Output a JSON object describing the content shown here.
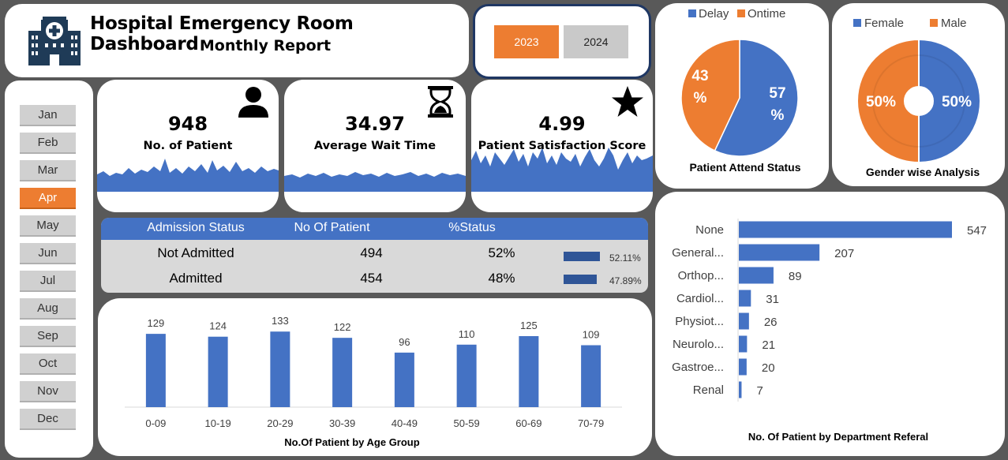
{
  "header": {
    "title": "Hospital Emergency Room Dashboard",
    "subtitle": "Monthly Report",
    "logo_icon": "hospital-icon"
  },
  "years": [
    {
      "label": "2023",
      "active": true
    },
    {
      "label": "2024",
      "active": false
    }
  ],
  "months": [
    {
      "label": "Jan",
      "active": false
    },
    {
      "label": "Feb",
      "active": false
    },
    {
      "label": "Mar",
      "active": false
    },
    {
      "label": "Apr",
      "active": true
    },
    {
      "label": "May",
      "active": false
    },
    {
      "label": "Jun",
      "active": false
    },
    {
      "label": "Jul",
      "active": false
    },
    {
      "label": "Aug",
      "active": false
    },
    {
      "label": "Sep",
      "active": false
    },
    {
      "label": "Oct",
      "active": false
    },
    {
      "label": "Nov",
      "active": false
    },
    {
      "label": "Dec",
      "active": false
    }
  ],
  "kpis": [
    {
      "value": "948",
      "label": "No. of Patient",
      "icon": "person-icon"
    },
    {
      "value": "34.97",
      "label": "Average Wait Time",
      "icon": "hourglass-icon"
    },
    {
      "value": "4.99",
      "label": "Patient Satisfaction Score",
      "icon": "star-icon"
    }
  ],
  "admission": {
    "headers": [
      "Admission Status",
      "No  Of  Patient",
      "%Status"
    ],
    "rows": [
      {
        "status": "Not Admitted",
        "count": "494",
        "pct": "52%",
        "bar_pct": "52.11%",
        "bar_value": 52.11
      },
      {
        "status": "Admitted",
        "count": "454",
        "pct": "48%",
        "bar_pct": "47.89%",
        "bar_value": 47.89
      }
    ]
  },
  "colors": {
    "blue": "#4472c4",
    "orange": "#ed7d31",
    "darkblue": "#2f5597"
  },
  "chart_data": [
    {
      "type": "bar",
      "title": "No.Of Patient by Age Group",
      "categories": [
        "0-09",
        "10-19",
        "20-29",
        "30-39",
        "40-49",
        "50-59",
        "60-69",
        "70-79"
      ],
      "values": [
        129,
        124,
        133,
        122,
        96,
        110,
        125,
        109
      ],
      "ylim": [
        0,
        150
      ],
      "grid": false
    },
    {
      "type": "pie",
      "title": "Patient Attend Status",
      "labels": [
        "Delay",
        "Ontime"
      ],
      "values": [
        57,
        43
      ],
      "value_labels": [
        "57 %",
        "43 %"
      ],
      "legend": "top"
    },
    {
      "type": "pie",
      "title": "Gender wise Analysis",
      "labels": [
        "Female",
        "Male"
      ],
      "values": [
        50,
        50
      ],
      "value_labels": [
        "50%",
        "50%"
      ],
      "legend": "top",
      "donut": true
    },
    {
      "type": "bar",
      "orientation": "horizontal",
      "title": "No. Of Patient by Department Referal",
      "categories": [
        "None",
        "General...",
        "Orthop...",
        "Cardiol...",
        "Physiot...",
        "Neurolo...",
        "Gastroe...",
        "Renal"
      ],
      "values": [
        547,
        207,
        89,
        31,
        26,
        21,
        20,
        7
      ],
      "xlim": [
        0,
        600
      ],
      "grid": false
    }
  ]
}
